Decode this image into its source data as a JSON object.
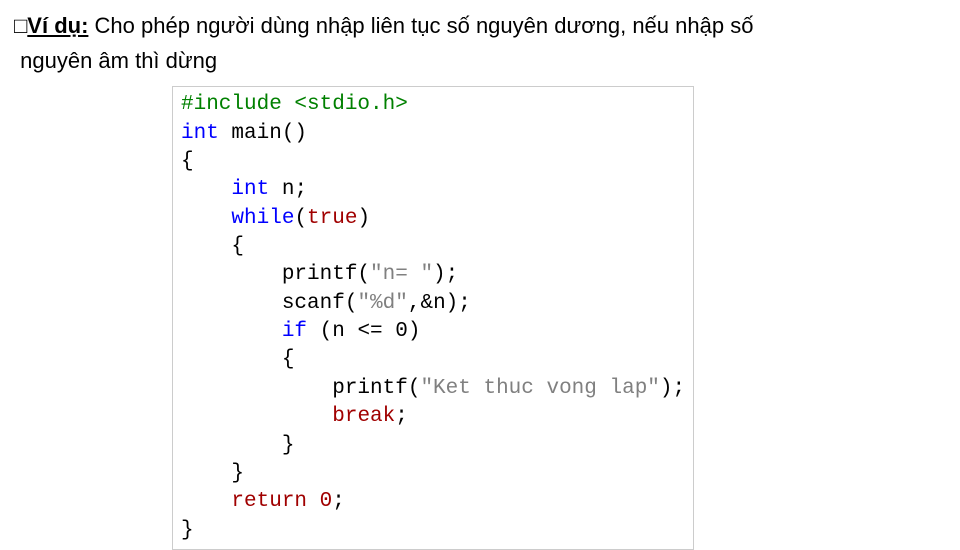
{
  "instruction": {
    "bullet": "□",
    "label": "Ví dụ:",
    "line1_rest": " Cho phép người dùng nhập liên tục số nguyên dương, nếu nhập số",
    "line2": "nguyên âm thì dừng"
  },
  "code": {
    "l1_pre": "#include <stdio.h>",
    "l2_kw": "int",
    "l2_rest": " main()",
    "l3": "{",
    "l4_indent": "    ",
    "l4_kw": "int",
    "l4_rest": " n;",
    "l5_indent": "    ",
    "l5_kw": "while",
    "l5_paren_open": "(",
    "l5_true": "true",
    "l5_paren_close": ")",
    "l6": "    {",
    "l7_indent": "        printf(",
    "l7_str": "\"n= \"",
    "l7_end": ");",
    "l8_indent": "        scanf(",
    "l8_str": "\"%d\"",
    "l8_end": ",&n);",
    "l9_indent": "        ",
    "l9_kw": "if",
    "l9_rest": " (n <= 0)",
    "l10": "        {",
    "l11_indent": "            printf(",
    "l11_str": "\"Ket thuc vong lap\"",
    "l11_end": ");",
    "l12_indent": "            ",
    "l12_break": "break",
    "l12_semi": ";",
    "l13": "        }",
    "l14": "    }",
    "l15_indent": "    ",
    "l15_return": "return",
    "l15_zero": " 0",
    "l15_semi": ";",
    "l16": "}"
  }
}
